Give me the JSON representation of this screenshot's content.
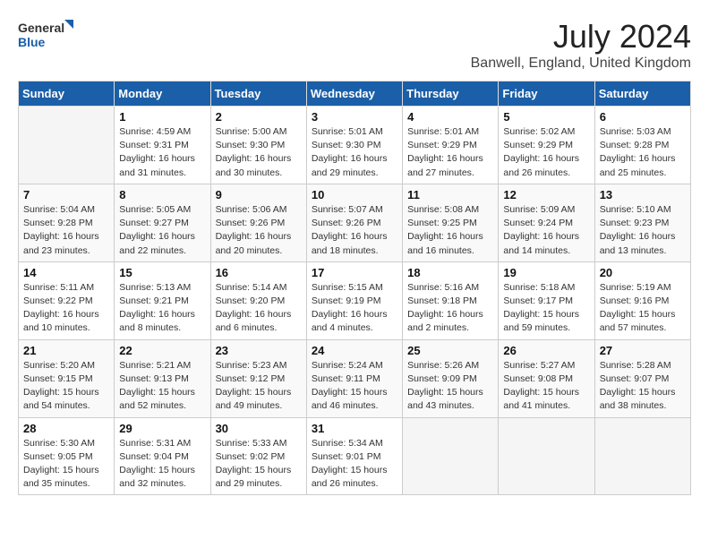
{
  "header": {
    "logo_general": "General",
    "logo_blue": "Blue",
    "month": "July 2024",
    "location": "Banwell, England, United Kingdom"
  },
  "weekdays": [
    "Sunday",
    "Monday",
    "Tuesday",
    "Wednesday",
    "Thursday",
    "Friday",
    "Saturday"
  ],
  "weeks": [
    [
      {
        "day": "",
        "info": ""
      },
      {
        "day": "1",
        "info": "Sunrise: 4:59 AM\nSunset: 9:31 PM\nDaylight: 16 hours\nand 31 minutes."
      },
      {
        "day": "2",
        "info": "Sunrise: 5:00 AM\nSunset: 9:30 PM\nDaylight: 16 hours\nand 30 minutes."
      },
      {
        "day": "3",
        "info": "Sunrise: 5:01 AM\nSunset: 9:30 PM\nDaylight: 16 hours\nand 29 minutes."
      },
      {
        "day": "4",
        "info": "Sunrise: 5:01 AM\nSunset: 9:29 PM\nDaylight: 16 hours\nand 27 minutes."
      },
      {
        "day": "5",
        "info": "Sunrise: 5:02 AM\nSunset: 9:29 PM\nDaylight: 16 hours\nand 26 minutes."
      },
      {
        "day": "6",
        "info": "Sunrise: 5:03 AM\nSunset: 9:28 PM\nDaylight: 16 hours\nand 25 minutes."
      }
    ],
    [
      {
        "day": "7",
        "info": "Sunrise: 5:04 AM\nSunset: 9:28 PM\nDaylight: 16 hours\nand 23 minutes."
      },
      {
        "day": "8",
        "info": "Sunrise: 5:05 AM\nSunset: 9:27 PM\nDaylight: 16 hours\nand 22 minutes."
      },
      {
        "day": "9",
        "info": "Sunrise: 5:06 AM\nSunset: 9:26 PM\nDaylight: 16 hours\nand 20 minutes."
      },
      {
        "day": "10",
        "info": "Sunrise: 5:07 AM\nSunset: 9:26 PM\nDaylight: 16 hours\nand 18 minutes."
      },
      {
        "day": "11",
        "info": "Sunrise: 5:08 AM\nSunset: 9:25 PM\nDaylight: 16 hours\nand 16 minutes."
      },
      {
        "day": "12",
        "info": "Sunrise: 5:09 AM\nSunset: 9:24 PM\nDaylight: 16 hours\nand 14 minutes."
      },
      {
        "day": "13",
        "info": "Sunrise: 5:10 AM\nSunset: 9:23 PM\nDaylight: 16 hours\nand 13 minutes."
      }
    ],
    [
      {
        "day": "14",
        "info": "Sunrise: 5:11 AM\nSunset: 9:22 PM\nDaylight: 16 hours\nand 10 minutes."
      },
      {
        "day": "15",
        "info": "Sunrise: 5:13 AM\nSunset: 9:21 PM\nDaylight: 16 hours\nand 8 minutes."
      },
      {
        "day": "16",
        "info": "Sunrise: 5:14 AM\nSunset: 9:20 PM\nDaylight: 16 hours\nand 6 minutes."
      },
      {
        "day": "17",
        "info": "Sunrise: 5:15 AM\nSunset: 9:19 PM\nDaylight: 16 hours\nand 4 minutes."
      },
      {
        "day": "18",
        "info": "Sunrise: 5:16 AM\nSunset: 9:18 PM\nDaylight: 16 hours\nand 2 minutes."
      },
      {
        "day": "19",
        "info": "Sunrise: 5:18 AM\nSunset: 9:17 PM\nDaylight: 15 hours\nand 59 minutes."
      },
      {
        "day": "20",
        "info": "Sunrise: 5:19 AM\nSunset: 9:16 PM\nDaylight: 15 hours\nand 57 minutes."
      }
    ],
    [
      {
        "day": "21",
        "info": "Sunrise: 5:20 AM\nSunset: 9:15 PM\nDaylight: 15 hours\nand 54 minutes."
      },
      {
        "day": "22",
        "info": "Sunrise: 5:21 AM\nSunset: 9:13 PM\nDaylight: 15 hours\nand 52 minutes."
      },
      {
        "day": "23",
        "info": "Sunrise: 5:23 AM\nSunset: 9:12 PM\nDaylight: 15 hours\nand 49 minutes."
      },
      {
        "day": "24",
        "info": "Sunrise: 5:24 AM\nSunset: 9:11 PM\nDaylight: 15 hours\nand 46 minutes."
      },
      {
        "day": "25",
        "info": "Sunrise: 5:26 AM\nSunset: 9:09 PM\nDaylight: 15 hours\nand 43 minutes."
      },
      {
        "day": "26",
        "info": "Sunrise: 5:27 AM\nSunset: 9:08 PM\nDaylight: 15 hours\nand 41 minutes."
      },
      {
        "day": "27",
        "info": "Sunrise: 5:28 AM\nSunset: 9:07 PM\nDaylight: 15 hours\nand 38 minutes."
      }
    ],
    [
      {
        "day": "28",
        "info": "Sunrise: 5:30 AM\nSunset: 9:05 PM\nDaylight: 15 hours\nand 35 minutes."
      },
      {
        "day": "29",
        "info": "Sunrise: 5:31 AM\nSunset: 9:04 PM\nDaylight: 15 hours\nand 32 minutes."
      },
      {
        "day": "30",
        "info": "Sunrise: 5:33 AM\nSunset: 9:02 PM\nDaylight: 15 hours\nand 29 minutes."
      },
      {
        "day": "31",
        "info": "Sunrise: 5:34 AM\nSunset: 9:01 PM\nDaylight: 15 hours\nand 26 minutes."
      },
      {
        "day": "",
        "info": ""
      },
      {
        "day": "",
        "info": ""
      },
      {
        "day": "",
        "info": ""
      }
    ]
  ]
}
